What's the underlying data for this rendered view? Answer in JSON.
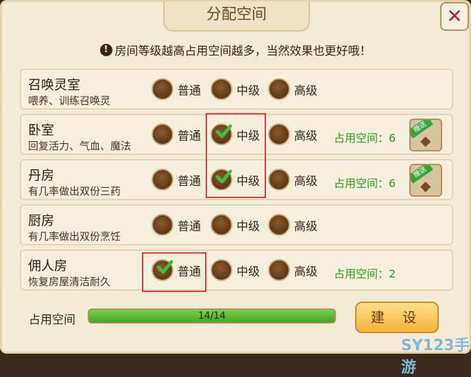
{
  "title": "分配空间",
  "close_icon": "close-icon",
  "notice": "房间等级越高占用空间越多，当然效果也更好哦！",
  "option_labels": [
    "普通",
    "中级",
    "高级"
  ],
  "space_label_prefix": "占用空间：",
  "rooms": [
    {
      "name": "召唤灵室",
      "desc": "喂养、训练召唤灵",
      "selected": null,
      "space": null,
      "gift": false
    },
    {
      "name": "卧室",
      "desc": "回复活力、气血、魔法",
      "selected": 1,
      "space": "6",
      "gift": true,
      "gift_label": "赠送"
    },
    {
      "name": "丹房",
      "desc": "有几率做出双份三药",
      "selected": 1,
      "space": "6",
      "gift": true,
      "gift_label": "赠送"
    },
    {
      "name": "厨房",
      "desc": "有几率做出双份烹饪",
      "selected": null,
      "space": null,
      "gift": false
    },
    {
      "name": "佣人房",
      "desc": "恢复房屋清洁耐久",
      "selected": 0,
      "space": "2",
      "gift": false
    }
  ],
  "footer": {
    "label": "占用空间",
    "progress_text": "14/14",
    "progress_fraction": 1.0,
    "build_button": "建 设"
  },
  "watermark": "SY123手游",
  "colors": {
    "accent_green": "#2e9a1e",
    "highlight_red": "#e23b3b",
    "button_gold": "#f3b53c"
  }
}
